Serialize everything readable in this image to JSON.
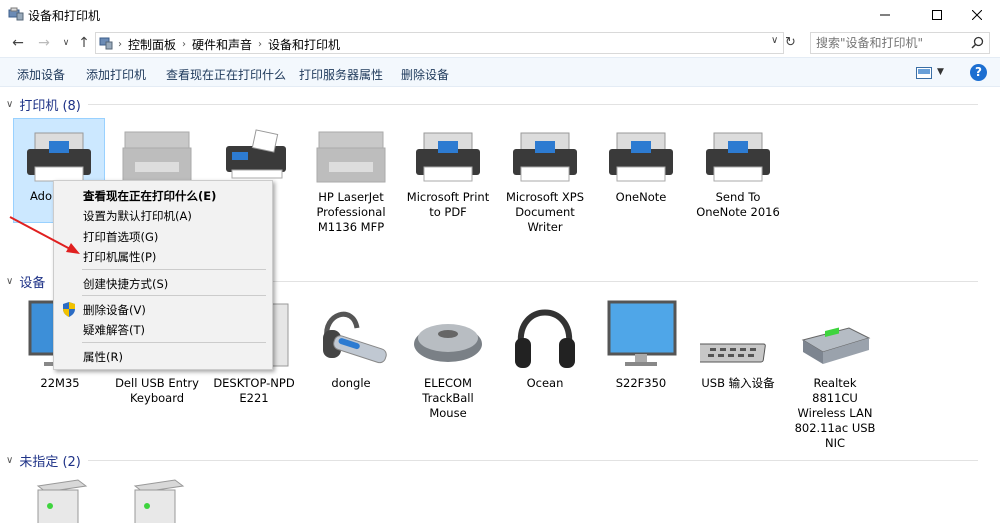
{
  "window": {
    "title": "设备和打印机"
  },
  "address": {
    "crumbs": [
      "控制面板",
      "硬件和声音",
      "设备和打印机"
    ]
  },
  "search": {
    "placeholder": "搜索\"设备和打印机\""
  },
  "commands": {
    "add_device": "添加设备",
    "add_printer": "添加打印机",
    "see_printing": "查看现在正在打印什么",
    "print_server": "打印服务器属性",
    "remove_device": "删除设备"
  },
  "groups": {
    "printers": "打印机 (8)",
    "devices": "设备",
    "unspecified": "未指定 (2)"
  },
  "printers": [
    {
      "label": "Ado"
    },
    {
      "label": "HP LaserJet\nProfessional\nM1136 MFP"
    },
    {
      "label": "Microsoft Print\nto PDF"
    },
    {
      "label": "Microsoft XPS\nDocument\nWriter"
    },
    {
      "label": "OneNote"
    },
    {
      "label": "Send To\nOneNote 2016"
    }
  ],
  "devices": [
    {
      "label": "22M35"
    },
    {
      "label": "Dell USB Entry\nKeyboard"
    },
    {
      "label": "DESKTOP-NPD\nE221"
    },
    {
      "label": "dongle"
    },
    {
      "label": "ELECOM\nTrackBall\nMouse"
    },
    {
      "label": "Ocean"
    },
    {
      "label": "S22F350"
    },
    {
      "label": "USB 输入设备"
    },
    {
      "label": "Realtek 8811CU\nWireless LAN\n802.11ac USB\nNIC"
    }
  ],
  "context_menu": {
    "see_printing": "查看现在正在打印什么(E)",
    "set_default": "设置为默认打印机(A)",
    "preferences": "打印首选项(G)",
    "printer_properties": "打印机属性(P)",
    "create_shortcut": "创建快捷方式(S)",
    "remove_device": "删除设备(V)",
    "troubleshoot": "疑难解答(T)",
    "properties": "属性(R)"
  },
  "help": {
    "label": "?"
  }
}
